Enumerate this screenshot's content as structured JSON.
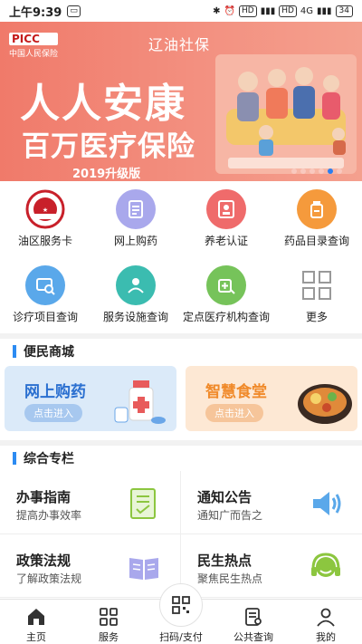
{
  "status_bar": {
    "time": "上午9:39",
    "network_hd1": "HD",
    "network_4g1": "4G",
    "network_hd2": "HD",
    "network_4g2": "4G",
    "battery": "34"
  },
  "banner": {
    "brand": "PICC",
    "brand_cn": "中国人民保险",
    "city": "辽油社保",
    "title_line1": "人人安康",
    "title_line2": "百万医疗保险",
    "edition": "2019升级版",
    "colors": {
      "bg": "#f07a6a",
      "dot_active": "#2b7ef0"
    }
  },
  "services": [
    {
      "label": "油区服务卡",
      "icon": "social-security-card-icon",
      "color": "#c8202a"
    },
    {
      "label": "网上购药",
      "icon": "document-icon",
      "color": "#a9a8ec"
    },
    {
      "label": "养老认证",
      "icon": "id-card-icon",
      "color": "#ef6b6b"
    },
    {
      "label": "药品目录查询",
      "icon": "pill-bottle-icon",
      "color": "#f59a3c"
    },
    {
      "label": "诊疗项目查询",
      "icon": "monitor-search-icon",
      "color": "#5aa8ea"
    },
    {
      "label": "服务设施查询",
      "icon": "handshake-icon",
      "color": "#3bbcb0"
    },
    {
      "label": "定点医疗机构查询",
      "icon": "hospital-search-icon",
      "color": "#76c35a"
    },
    {
      "label": "更多",
      "icon": "grid-more-icon",
      "color": "#999999"
    }
  ],
  "mall": {
    "title": "便民商城",
    "cards": [
      {
        "title": "网上购药",
        "button": "点击进入",
        "title_color": "#2a6fd0",
        "bg": "#dbeaf9",
        "btn_bg": "#a7c8ef"
      },
      {
        "title": "智慧食堂",
        "button": "点击进入",
        "title_color": "#f08a2a",
        "bg": "#fde8d4",
        "btn_bg": "#f6c59a"
      }
    ]
  },
  "special": {
    "title": "综合专栏",
    "tiles": [
      {
        "title": "办事指南",
        "subtitle": "提高办事效率",
        "icon": "checklist-icon"
      },
      {
        "title": "通知公告",
        "subtitle": "通知广而告之",
        "icon": "speaker-icon"
      },
      {
        "title": "政策法规",
        "subtitle": "了解政策法规",
        "icon": "open-book-icon"
      },
      {
        "title": "民生热点",
        "subtitle": "聚焦民生热点",
        "icon": "headset-icon"
      }
    ]
  },
  "tabbar": {
    "items": [
      {
        "label": "主页",
        "icon": "home-icon"
      },
      {
        "label": "服务",
        "icon": "apps-icon"
      },
      {
        "label": "扫码/支付",
        "icon": "qr-scan-icon"
      },
      {
        "label": "公共查询",
        "icon": "query-icon"
      },
      {
        "label": "我的",
        "icon": "user-icon"
      }
    ]
  }
}
